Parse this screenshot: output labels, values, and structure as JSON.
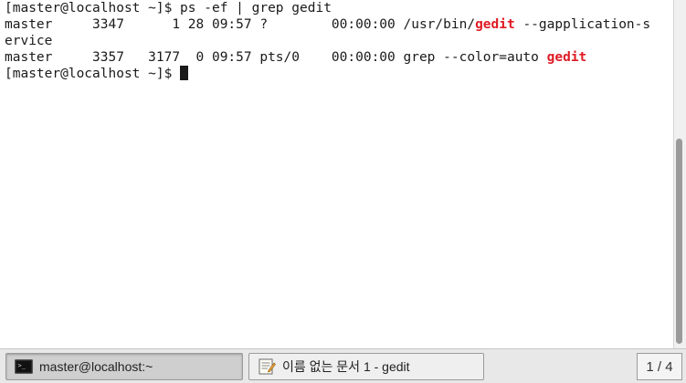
{
  "terminal": {
    "lines": [
      {
        "text": "[master@localhost ~]$ ps -ef | grep gedit"
      },
      {
        "pre": "master     3347      1 28 09:57 ?        00:00:00 /usr/bin/",
        "hl": "gedit",
        "post": " --gapplication-s"
      },
      {
        "text": "ervice"
      },
      {
        "pre": "master     3357   3177  0 09:57 pts/0    00:00:00 grep --color=auto ",
        "hl": "gedit",
        "post": ""
      },
      {
        "text": "[master@localhost ~]$ "
      }
    ],
    "highlight_color": "#e01b24"
  },
  "taskbar": {
    "terminal_task_label": "master@localhost:~",
    "gedit_task_label": "이름 없는 문서 1 - gedit",
    "workspace_indicator": "1 / 4",
    "terminal_icon": "terminal-icon",
    "gedit_icon": "text-editor-icon"
  }
}
